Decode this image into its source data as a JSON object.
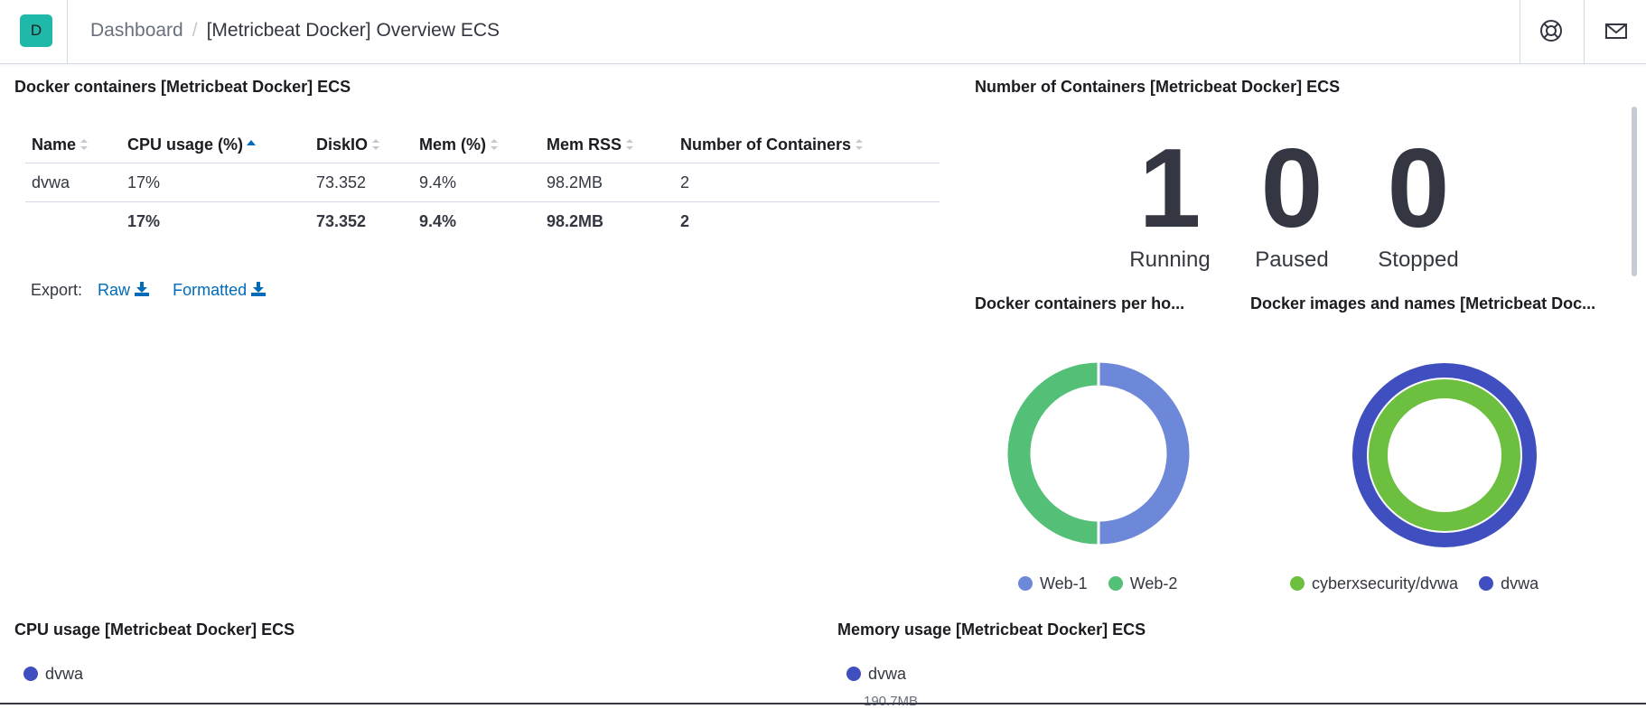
{
  "header": {
    "avatar_letter": "D",
    "breadcrumb_root": "Dashboard",
    "breadcrumb_separator": "/",
    "breadcrumb_current": "[Metricbeat Docker] Overview ECS",
    "icons": [
      "help-icon",
      "mail-icon"
    ]
  },
  "containers_table": {
    "title": "Docker containers [Metricbeat Docker] ECS",
    "columns": [
      "Name",
      "CPU usage (%)",
      "DiskIO",
      "Mem (%)",
      "Mem RSS",
      "Number of Containers"
    ],
    "rows": [
      [
        "dvwa",
        "17%",
        "73.352",
        "9.4%",
        "98.2MB",
        "2"
      ]
    ],
    "totals": [
      "",
      "17%",
      "73.352",
      "9.4%",
      "98.2MB",
      "2"
    ],
    "export": {
      "label": "Export:",
      "raw": "Raw",
      "formatted": "Formatted"
    }
  },
  "number_of_containers": {
    "title": "Number of Containers [Metricbeat Docker] ECS",
    "metrics": [
      {
        "value": "1",
        "label": "Running"
      },
      {
        "value": "0",
        "label": "Paused"
      },
      {
        "value": "0",
        "label": "Stopped"
      }
    ]
  },
  "per_host": {
    "title": "Docker containers per ho...",
    "legend": [
      {
        "name": "Web-1",
        "color": "#6e88d9"
      },
      {
        "name": "Web-2",
        "color": "#54c077"
      }
    ]
  },
  "images_names": {
    "title": "Docker images and names [Metricbeat Doc...",
    "legend": [
      {
        "name": "cyberxsecurity/dvwa",
        "color": "#6dbf3f"
      },
      {
        "name": "dvwa",
        "color": "#3f4fbf"
      }
    ]
  },
  "cpu_usage": {
    "title": "CPU usage [Metricbeat Docker] ECS",
    "legend": [
      {
        "name": "dvwa",
        "color": "#3f4fbf"
      }
    ]
  },
  "memory_usage": {
    "title": "Memory usage [Metricbeat Docker] ECS",
    "legend": [
      {
        "name": "dvwa",
        "color": "#3f4fbf"
      }
    ],
    "partial_axis_label": "190.7MB"
  },
  "chart_data": [
    {
      "type": "pie",
      "title": "Docker containers per ho...",
      "categories": [
        "Web-1",
        "Web-2"
      ],
      "values": [
        50,
        50
      ],
      "colors": [
        "#6e88d9",
        "#54c077"
      ]
    },
    {
      "type": "pie",
      "title": "Docker images and names [Metricbeat Doc...",
      "rings": [
        {
          "categories": [
            "dvwa"
          ],
          "values": [
            100
          ],
          "colors": [
            "#3f4fbf"
          ]
        },
        {
          "categories": [
            "cyberxsecurity/dvwa"
          ],
          "values": [
            100
          ],
          "colors": [
            "#6dbf3f"
          ]
        }
      ]
    }
  ]
}
